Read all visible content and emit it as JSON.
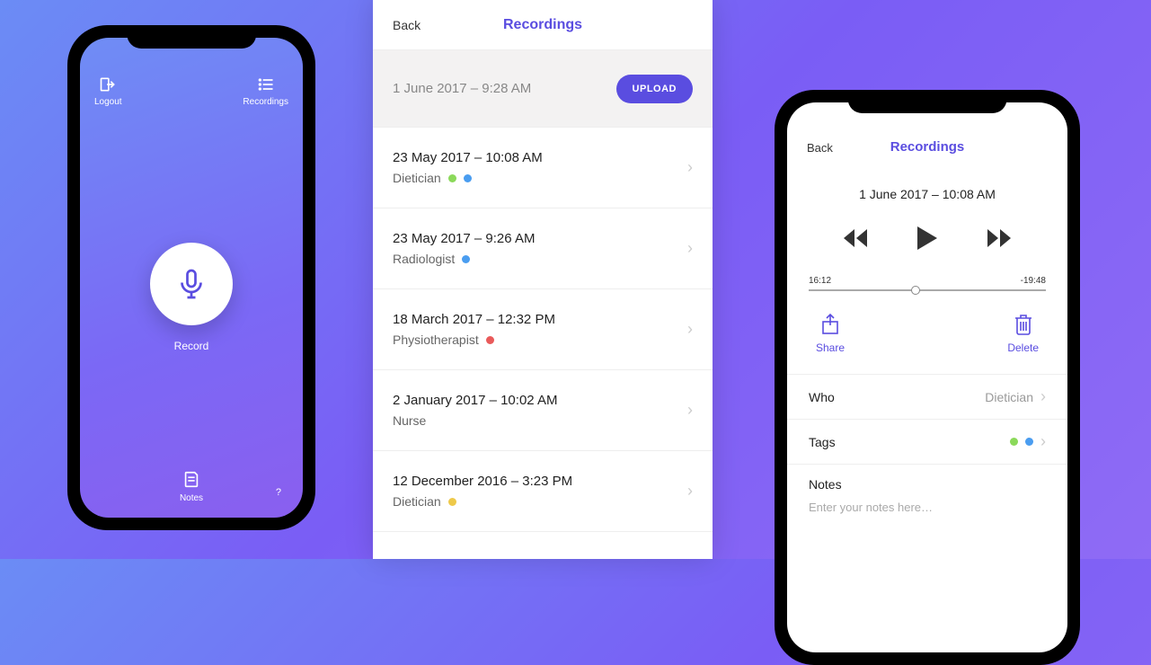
{
  "colors": {
    "accent": "#5a4de0",
    "dot_green": "#8bd95a",
    "dot_blue": "#4a9df0",
    "dot_red": "#e95a5a",
    "dot_yellow": "#eec94a"
  },
  "phone1": {
    "logout_label": "Logout",
    "recordings_label": "Recordings",
    "record_label": "Record",
    "notes_label": "Notes",
    "help_label": "?"
  },
  "list": {
    "back_label": "Back",
    "title": "Recordings",
    "upload_date": "1 June 2017 – 9:28 AM",
    "upload_button": "UPLOAD",
    "items": [
      {
        "date": "23 May 2017 – 10:08 AM",
        "role": "Dietician",
        "dots": [
          "green",
          "blue"
        ]
      },
      {
        "date": "23 May 2017 – 9:26 AM",
        "role": "Radiologist",
        "dots": [
          "blue"
        ]
      },
      {
        "date": "18 March 2017 – 12:32 PM",
        "role": "Physiotherapist",
        "dots": [
          "red"
        ]
      },
      {
        "date": "2 January 2017 – 10:02 AM",
        "role": "Nurse",
        "dots": []
      },
      {
        "date": "12 December 2016 – 3:23 PM",
        "role": "Dietician",
        "dots": [
          "yellow"
        ]
      }
    ]
  },
  "player": {
    "back_label": "Back",
    "title": "Recordings",
    "date": "1 June 2017 – 10:08 AM",
    "time_elapsed": "16:12",
    "time_remaining": "-19:48",
    "share_label": "Share",
    "delete_label": "Delete",
    "who_label": "Who",
    "who_value": "Dietician",
    "tags_label": "Tags",
    "notes_label": "Notes",
    "notes_placeholder": "Enter your notes here…"
  }
}
